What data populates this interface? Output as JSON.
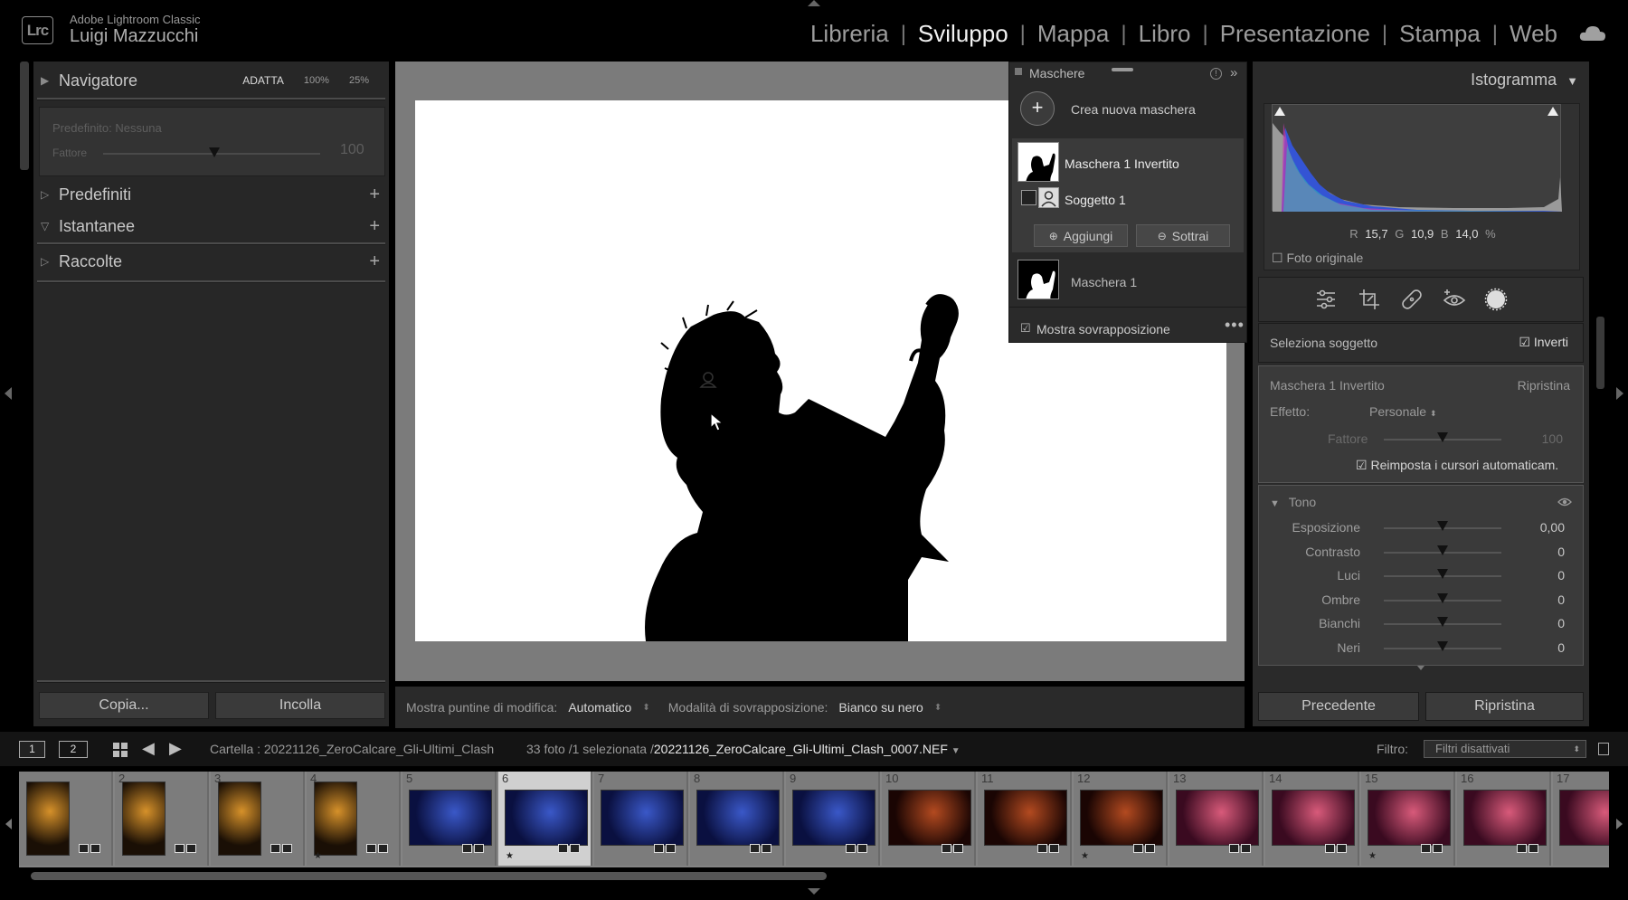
{
  "app": {
    "name": "Adobe Lightroom Classic",
    "user": "Luigi Mazzucchi",
    "logo": "Lrc"
  },
  "modules": [
    {
      "label": "Libreria",
      "active": false
    },
    {
      "label": "Sviluppo",
      "active": true
    },
    {
      "label": "Mappa",
      "active": false
    },
    {
      "label": "Libro",
      "active": false
    },
    {
      "label": "Presentazione",
      "active": false
    },
    {
      "label": "Stampa",
      "active": false
    },
    {
      "label": "Web",
      "active": false
    }
  ],
  "left_panel": {
    "navigator": {
      "title": "Navigatore",
      "fit": "ADATTA",
      "zoom1": "100%",
      "zoom2": "25%"
    },
    "preset_amount": {
      "preset": "Predefinito: Nessuna",
      "label": "Fattore",
      "value": "100",
      "level": 1.0
    },
    "sections": [
      {
        "title": "Predefiniti",
        "plus": "+"
      },
      {
        "title": "Istantanee",
        "plus": "+"
      },
      {
        "title": "Raccolte",
        "plus": "+"
      }
    ],
    "copy_label": "Copia...",
    "paste_label": "Incolla"
  },
  "toolbar": {
    "pins_label": "Mostra puntine di modifica:",
    "pins_value": "Automatico",
    "overlay_label": "Modalità di sovrapposizione:",
    "overlay_value": "Bianco su nero"
  },
  "masks": {
    "title": "Maschere",
    "create_label": "Crea nuova maschera",
    "mask1": "Maschera 1 Invertito",
    "subject": "Soggetto 1",
    "add_label": "Aggiungi",
    "subtract_label": "Sottrai",
    "mask2": "Maschera 1",
    "show_overlay": "Mostra sovrapposizione",
    "show_overlay_checked": true
  },
  "right_panel": {
    "histogram_title": "Istogramma",
    "rgb": {
      "r_label": "R",
      "r": "15,7",
      "g_label": "G",
      "g": "10,9",
      "b_label": "B",
      "b": "14,0",
      "unit": "%"
    },
    "original_photo": "Foto originale",
    "select_subject": "Seleziona soggetto",
    "invert_label": "Inverti",
    "invert_checked": true,
    "mask_name": "Maschera 1 Invertito",
    "reset_label": "Ripristina",
    "effect_label": "Effetto:",
    "effect_value": "Personale",
    "amount_label": "Fattore",
    "amount_value": "100",
    "auto_reset": "Reimposta i cursori automaticam.",
    "tone_title": "Tono",
    "tone_sliders": [
      {
        "label": "Esposizione",
        "value": "0,00"
      },
      {
        "label": "Contrasto",
        "value": "0"
      },
      {
        "label": "Luci",
        "value": "0"
      },
      {
        "label": "Ombre",
        "value": "0"
      },
      {
        "label": "Bianchi",
        "value": "0"
      },
      {
        "label": "Neri",
        "value": "0"
      }
    ],
    "previous_label": "Precedente",
    "reset_button": "Ripristina"
  },
  "filmbar": {
    "screen1": "1",
    "screen2": "2",
    "folder": "Cartella : 20221126_ZeroCalcare_Gli-Ultimi_Clash",
    "count": "33 foto /1 selezionata /",
    "file": "20221126_ZeroCalcare_Gli-Ultimi_Clash_0007.NEF",
    "filter_label": "Filtro:",
    "filter_value": "Filtri disattivati"
  },
  "filmstrip": [
    {
      "num": "",
      "star": false,
      "theme": "warm-stage"
    },
    {
      "num": "2",
      "star": false,
      "theme": "warm-stage"
    },
    {
      "num": "3",
      "star": false,
      "theme": "warm-stage"
    },
    {
      "num": "4",
      "star": true,
      "theme": "warm-stage"
    },
    {
      "num": "5",
      "star": false,
      "theme": "blue-stage"
    },
    {
      "num": "6",
      "star": true,
      "theme": "blue-stage",
      "selected": true
    },
    {
      "num": "7",
      "star": false,
      "theme": "blue-stage"
    },
    {
      "num": "8",
      "star": false,
      "theme": "blue-stage"
    },
    {
      "num": "9",
      "star": false,
      "theme": "blue-stage"
    },
    {
      "num": "10",
      "star": false,
      "theme": "red-stage"
    },
    {
      "num": "11",
      "star": false,
      "theme": "red-stage"
    },
    {
      "num": "12",
      "star": true,
      "theme": "red-stage"
    },
    {
      "num": "13",
      "star": false,
      "theme": "crowd"
    },
    {
      "num": "14",
      "star": false,
      "theme": "crowd"
    },
    {
      "num": "15",
      "star": true,
      "theme": "crowd"
    },
    {
      "num": "16",
      "star": false,
      "theme": "crowd"
    },
    {
      "num": "17",
      "star": false,
      "theme": "crowd"
    }
  ],
  "colors": {
    "accent": "#ececec",
    "panel": "#2a2a2a",
    "background": "#000000"
  }
}
